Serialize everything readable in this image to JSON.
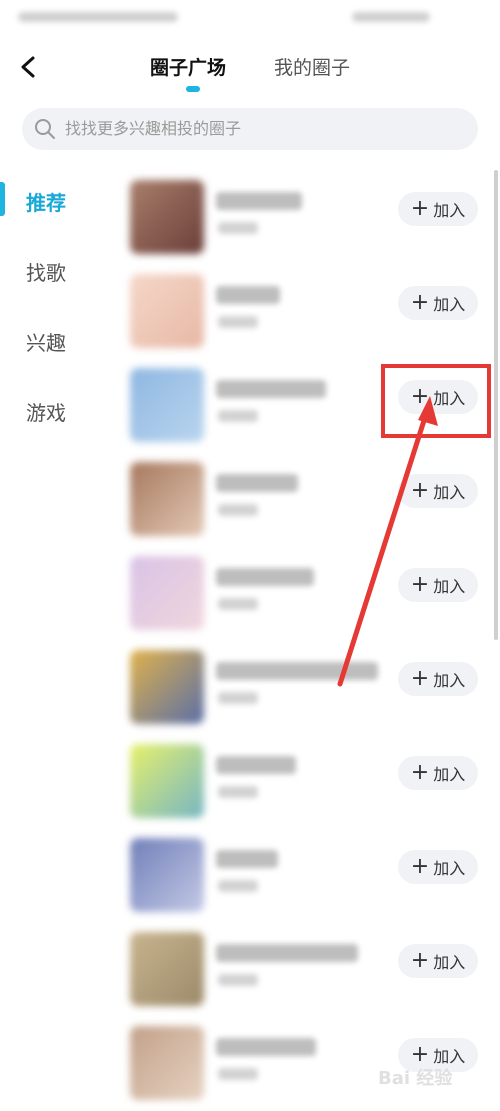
{
  "header": {
    "tabs": [
      {
        "label": "圈子广场",
        "active": true
      },
      {
        "label": "我的圈子",
        "active": false
      }
    ]
  },
  "search": {
    "placeholder": "找找更多兴趣相投的圈子"
  },
  "sidebar": {
    "items": [
      {
        "label": "推荐",
        "active": true
      },
      {
        "label": "找歌",
        "active": false
      },
      {
        "label": "兴趣",
        "active": false
      },
      {
        "label": "游戏",
        "active": false
      }
    ]
  },
  "circles": {
    "join_label": "加入",
    "join_plus": "+",
    "items": [
      {
        "thumb_colors": [
          "#a87e6a",
          "#6b3f3a"
        ]
      },
      {
        "thumb_colors": [
          "#f4d7c8",
          "#e8b8a6"
        ]
      },
      {
        "thumb_colors": [
          "#8fb7e2",
          "#b9d5ee"
        ]
      },
      {
        "thumb_colors": [
          "#a6785e",
          "#e3c8b5"
        ]
      },
      {
        "thumb_colors": [
          "#d9c3e6",
          "#f0d6dd"
        ]
      },
      {
        "thumb_colors": [
          "#e0b24a",
          "#5a6ea8"
        ]
      },
      {
        "thumb_colors": [
          "#e7f06b",
          "#75b6c4"
        ]
      },
      {
        "thumb_colors": [
          "#6f7fb8",
          "#c4c9e6"
        ]
      },
      {
        "thumb_colors": [
          "#c8b48e",
          "#9b8a6a"
        ]
      },
      {
        "thumb_colors": [
          "#c2a189",
          "#e6d2c1"
        ]
      }
    ]
  },
  "watermark": "Bai 经验",
  "colors": {
    "accent": "#1fb3e0",
    "annotation": "#e53935"
  }
}
